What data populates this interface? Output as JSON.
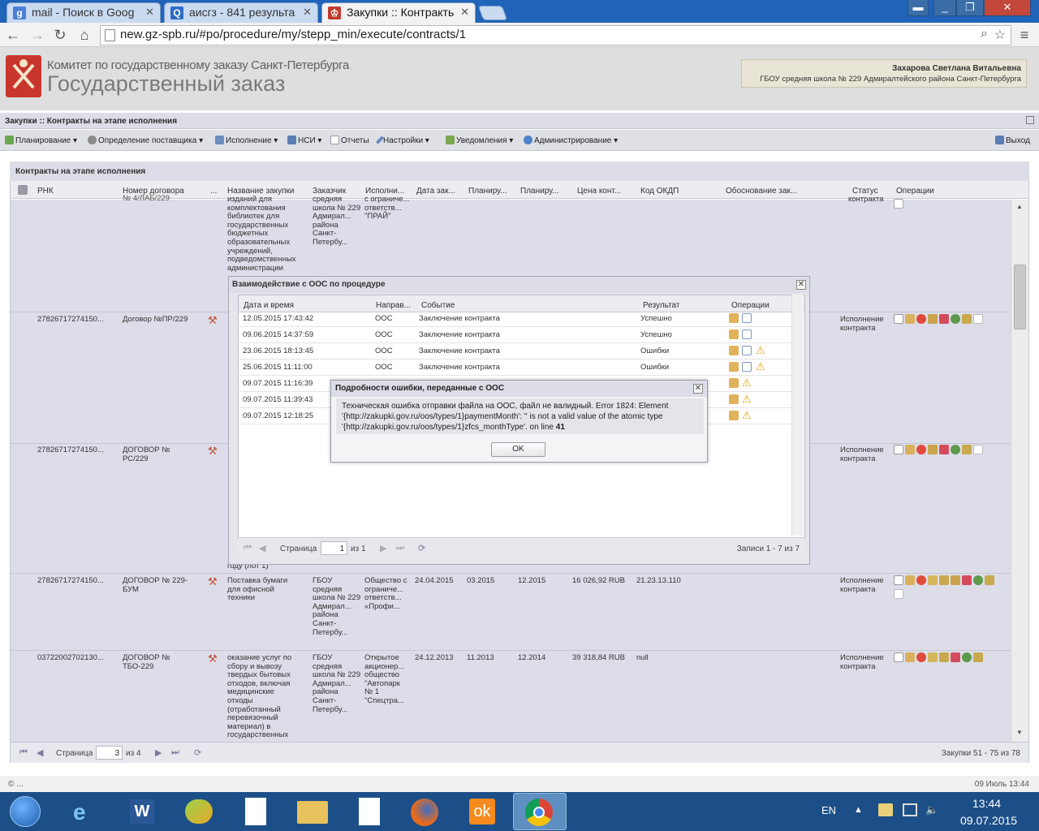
{
  "browser": {
    "tabs": [
      {
        "label": "mail - Поиск в Goog",
        "icon": "google-g-icon",
        "color": "#4a7fd4"
      },
      {
        "label": "аисгз - 841 результа",
        "icon": "search-q-icon",
        "color": "#2d6cc7"
      },
      {
        "label": "Закупки :: Контракть",
        "icon": "coat-of-arms-icon",
        "color": "#c13b2f"
      }
    ],
    "url": "new.gz-spb.ru/#po/procedure/my/stepp_min/execute/contracts/1"
  },
  "app": {
    "committee": "Комитет по государственному заказу Санкт-Петербурга",
    "title": "Государственный заказ",
    "user_name": "Захарова Светлана Витальевна",
    "user_org": "ГБОУ средняя школа № 229 Адмиралтейского района Санкт-Петербурга",
    "crumb": "Закупки :: Контракты на этапе исполнения",
    "menu": [
      {
        "label": "Планирование ▾",
        "color": "#6aa84f"
      },
      {
        "label": "Определение поставщика ▾",
        "color": "#7a7a7a"
      },
      {
        "label": "Исполнение ▾",
        "color": "#6b8cbf"
      },
      {
        "label": "НСИ ▾",
        "color": "#5b7fb5"
      },
      {
        "label": "Отчеты",
        "color": "#9a9a9a"
      },
      {
        "label": "Настройки ▾",
        "color": "#6b8cbf"
      },
      {
        "label": "Уведомления ▾",
        "color": "#7ba84e"
      },
      {
        "label": "Администрирование ▾",
        "color": "#4f82c8"
      }
    ],
    "logout": "Выход"
  },
  "grid": {
    "title": "Контракты на этапе исполнения",
    "columns": [
      "РНК",
      "Номер договора",
      "...",
      "Название закупки",
      "Заказчик",
      "Исполни...",
      "Дата зак...",
      "Планиру...",
      "Планиру...",
      "Цена конт...",
      "Код ОКДП",
      "Обоснование зак...",
      "Статус",
      "Операции"
    ],
    "row0": {
      "name": "изданий для комплектования библиотек для государственных бюджетных образовательных учреждений, подведомственных администрации",
      "customer": "средняя школа № 229 Адмирал... района Санкт-Петербу...",
      "supplier": "с ограниче... ответств... \"ПРАЙ\""
    },
    "row1": {
      "rnk": "27826717274150...",
      "num": "Договор №ПР/229",
      "status": "Исполнение контракта"
    },
    "row2": {
      "rnk": "27826717274150...",
      "num": "ДОГОВОР № РС/229",
      "status": "Исполнение контракта"
    },
    "row2_tail": "году (лот 1)",
    "row3": {
      "rnk": "27826717274150...",
      "num": "ДОГОВОР № 229-БУМ",
      "name": "Поставка бумаги для офисной техники",
      "customer": "ГБОУ средняя школа № 229 Адмирал... района Санкт-Петербу...",
      "supplier": "Общество с ограниче... ответств... «Профи...",
      "date": "24.04.2015",
      "plan_start": "03.2015",
      "plan_end": "12.2015",
      "price": "16 026,92 RUB",
      "okdp": "21.23.13.110",
      "status": "Исполнение контракта"
    },
    "row4": {
      "rnk": "03722002702130...",
      "num": "ДОГОВОР № ТБО-229",
      "name": "оказание услуг по сбору и вывозу твердых бытовых отходов, включая медицинские отходы (отработанный перевязочный материал) в государственных",
      "customer": "ГБОУ средняя школа № 229 Адмирал... района Санкт-Петербу...",
      "supplier": "Открытое акционер... общество \"Автопарк № 1 \"Спецтра...",
      "date": "24.12.2013",
      "plan_start": "11.2013",
      "plan_end": "12.2014",
      "price": "39 318,84 RUB",
      "okdp": "null",
      "status": "Исполнение контракта"
    },
    "pager": {
      "page_label": "Страница",
      "page": "3",
      "of": "из 4",
      "summary": "Закупки 51 - 75 из 78"
    }
  },
  "dialog_ooc": {
    "title": "Взаимодействие с ООС по процедуре",
    "columns": [
      "Дата и время",
      "Направ...",
      "Событие",
      "Результат",
      "Операции"
    ],
    "rows": [
      {
        "dt": "12.05.2015 17:43:42",
        "dir": "ООС",
        "event": "Заключение контракта",
        "result": "Успешно"
      },
      {
        "dt": "09.06.2015 14:37:59",
        "dir": "ООС",
        "event": "Заключение контракта",
        "result": "Успешно"
      },
      {
        "dt": "23.06.2015 18:13:45",
        "dir": "ООС",
        "event": "Заключение контракта",
        "result": "Ошибки"
      },
      {
        "dt": "25.06.2015 11:11:00",
        "dir": "ООС",
        "event": "Заключение контракта",
        "result": "Ошибки"
      },
      {
        "dt": "09.07.2015 11:16:39",
        "dir": "",
        "event": "",
        "result": ""
      },
      {
        "dt": "09.07.2015 11:39:43",
        "dir": "",
        "event": "",
        "result": ""
      },
      {
        "dt": "09.07.2015 12:18:25",
        "dir": "",
        "event": "",
        "result": ""
      }
    ],
    "pager": {
      "page_label": "Страница",
      "page": "1",
      "of": "из 1",
      "summary": "Записи 1 - 7 из 7"
    }
  },
  "dialog_error": {
    "title": "Подробности ошибки, переданные с ООС",
    "line1": "Техническая ошибка отправки файла на ООС, файл не валидный. Error 1824: Element",
    "line2": "'{http://zakupki.gov.ru/oos/types/1}paymentMonth': '' is not a valid value of the atomic type",
    "line3": "'{http://zakupki.gov.ru/oos/types/1}zfcs_monthType'. on line",
    "line_no": "41",
    "ok": "OK"
  },
  "status": {
    "left": "© ...",
    "right": "09 Июль 13:44"
  },
  "taskbar": {
    "lang": "EN",
    "time": "13:44",
    "date": "09.07.2015"
  }
}
